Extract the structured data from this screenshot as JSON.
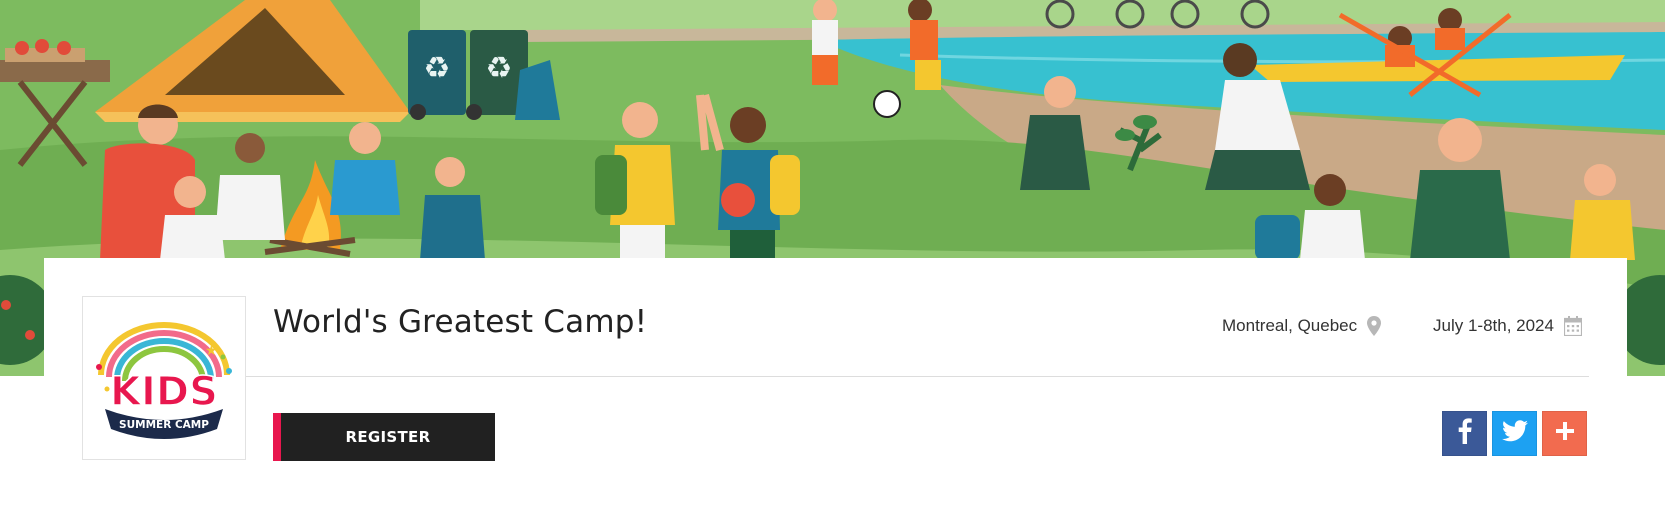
{
  "banner": {
    "icon": "camp-illustration"
  },
  "event": {
    "logo": {
      "line1": "KIDS",
      "line2": "SUMMER CAMP",
      "icon": "kids-summer-camp-logo"
    },
    "title": "World's Greatest Camp!",
    "location": "Montreal, Quebec",
    "location_icon": "map-pin-icon",
    "dates": "July 1-8th, 2024",
    "dates_icon": "calendar-icon"
  },
  "actions": {
    "register_label": "REGISTER",
    "register_accent": "#e8174e",
    "register_bg": "#212121"
  },
  "social": [
    {
      "name": "facebook",
      "glyph": "f",
      "color": "#3b5998"
    },
    {
      "name": "twitter",
      "glyph": "twitter-bird",
      "color": "#1da1f2"
    },
    {
      "name": "share",
      "glyph": "+",
      "color": "#f26b4f"
    }
  ]
}
